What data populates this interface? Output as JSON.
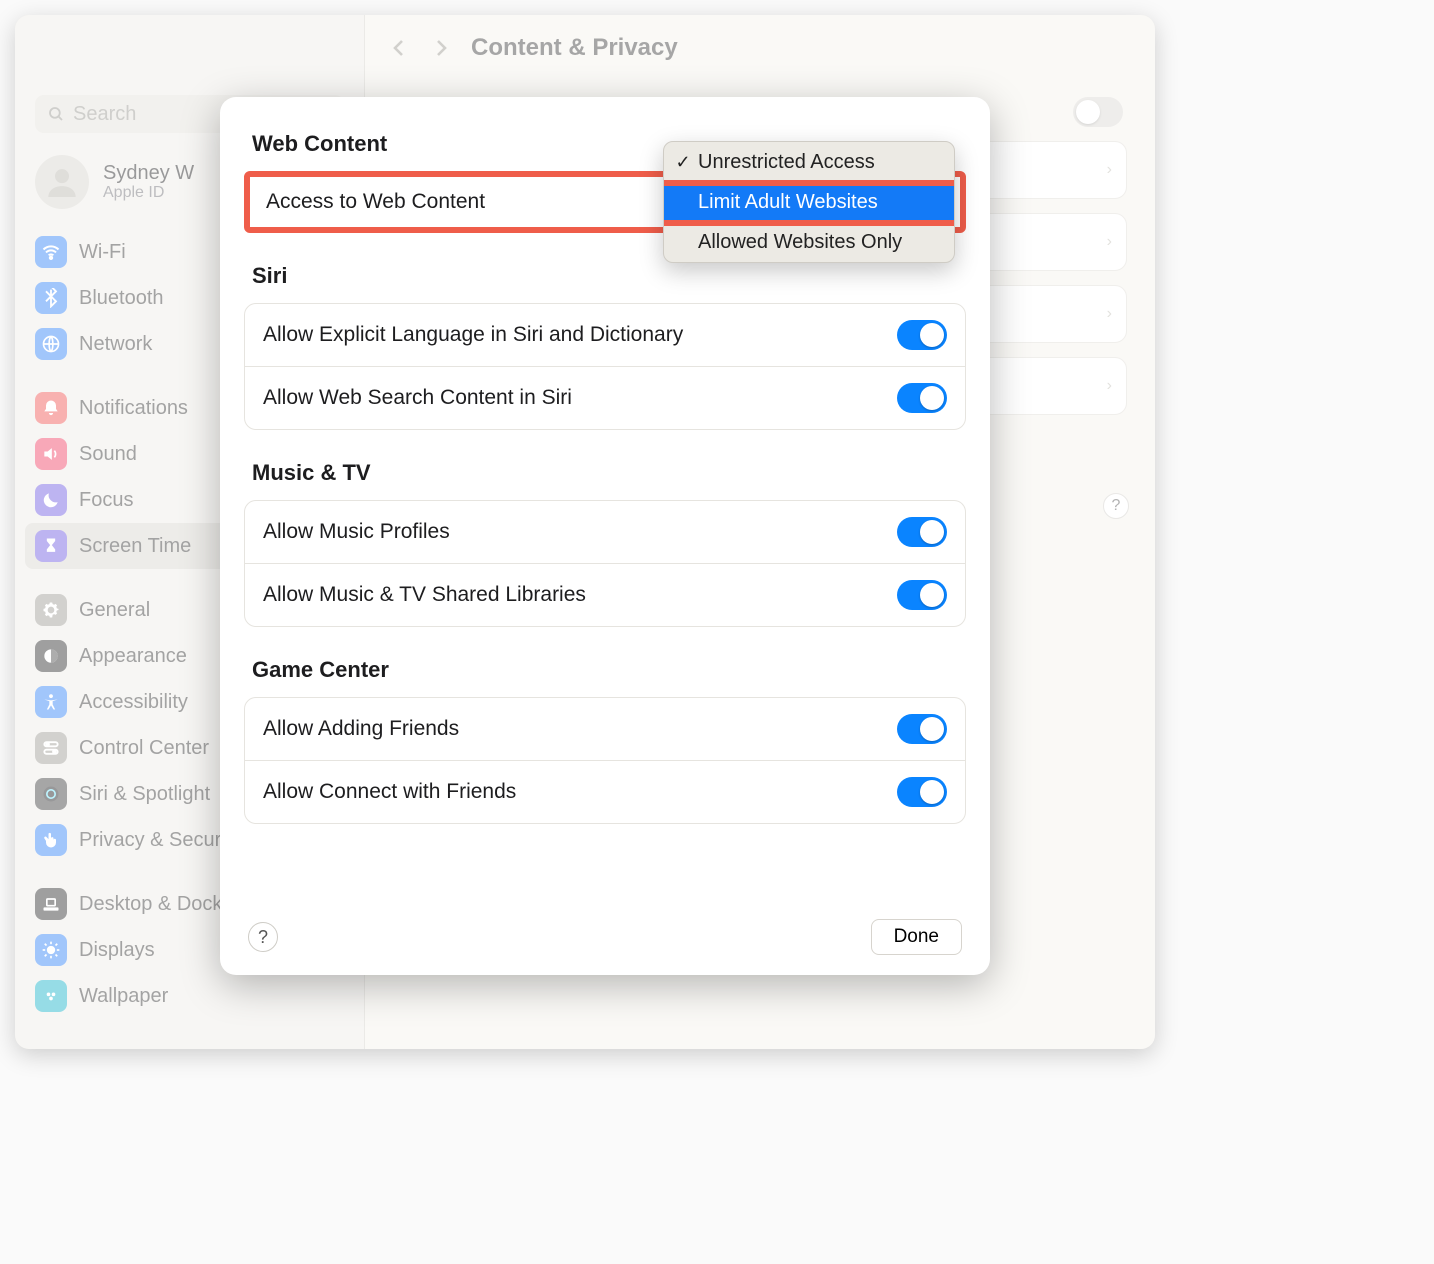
{
  "window": {
    "title": "Content & Privacy",
    "search_placeholder": "Search"
  },
  "profile": {
    "name": "Sydney W",
    "sub": "Apple ID"
  },
  "sidebar": [
    {
      "label": "Wi-Fi",
      "color": "#2f81f7",
      "icon": "wifi"
    },
    {
      "label": "Bluetooth",
      "color": "#2f81f7",
      "icon": "bluetooth"
    },
    {
      "label": "Network",
      "color": "#2f81f7",
      "icon": "network"
    },
    {
      "spacer": true
    },
    {
      "label": "Notifications",
      "color": "#ef5350",
      "icon": "bell"
    },
    {
      "label": "Sound",
      "color": "#ef3e63",
      "icon": "sound"
    },
    {
      "label": "Focus",
      "color": "#6e5ae0",
      "icon": "moon"
    },
    {
      "label": "Screen Time",
      "color": "#6e5ae0",
      "icon": "hourglass",
      "selected": true
    },
    {
      "spacer": true
    },
    {
      "label": "General",
      "color": "#9c9a93",
      "icon": "gear"
    },
    {
      "label": "Appearance",
      "color": "#2b2b2b",
      "icon": "appearance"
    },
    {
      "label": "Accessibility",
      "color": "#2f81f7",
      "icon": "accessibility"
    },
    {
      "label": "Control Center",
      "color": "#9c9a93",
      "icon": "controlcenter"
    },
    {
      "label": "Siri & Spotlight",
      "color": "#3b3b3b",
      "icon": "siri"
    },
    {
      "label": "Privacy & Security",
      "color": "#2f81f7",
      "icon": "hand"
    },
    {
      "spacer": true
    },
    {
      "label": "Desktop & Dock",
      "color": "#2b2b2b",
      "icon": "desktop"
    },
    {
      "label": "Displays",
      "color": "#2f81f7",
      "icon": "displays"
    },
    {
      "label": "Wallpaper",
      "color": "#17b1c8",
      "icon": "wallpaper"
    }
  ],
  "sheet": {
    "sections": [
      {
        "title": "Web Content"
      },
      {
        "title": "Siri",
        "rows": [
          {
            "label": "Allow Explicit Language in Siri and Dictionary",
            "on": true
          },
          {
            "label": "Allow Web Search Content in Siri",
            "on": true
          }
        ]
      },
      {
        "title": "Music & TV",
        "rows": [
          {
            "label": "Allow Music Profiles",
            "on": true
          },
          {
            "label": "Allow Music & TV Shared Libraries",
            "on": true
          }
        ]
      },
      {
        "title": "Game Center",
        "rows": [
          {
            "label": "Allow Adding Friends",
            "on": true
          },
          {
            "label": "Allow Connect with Friends",
            "on": true
          }
        ]
      }
    ],
    "web_row_label": "Access to Web Content",
    "dropdown": {
      "options": [
        {
          "label": "Unrestricted Access",
          "checked": true
        },
        {
          "label": "Limit Adult Websites",
          "selected": true
        },
        {
          "label": "Allowed Websites Only"
        }
      ]
    },
    "done_label": "Done"
  },
  "background_toggle_on": true
}
